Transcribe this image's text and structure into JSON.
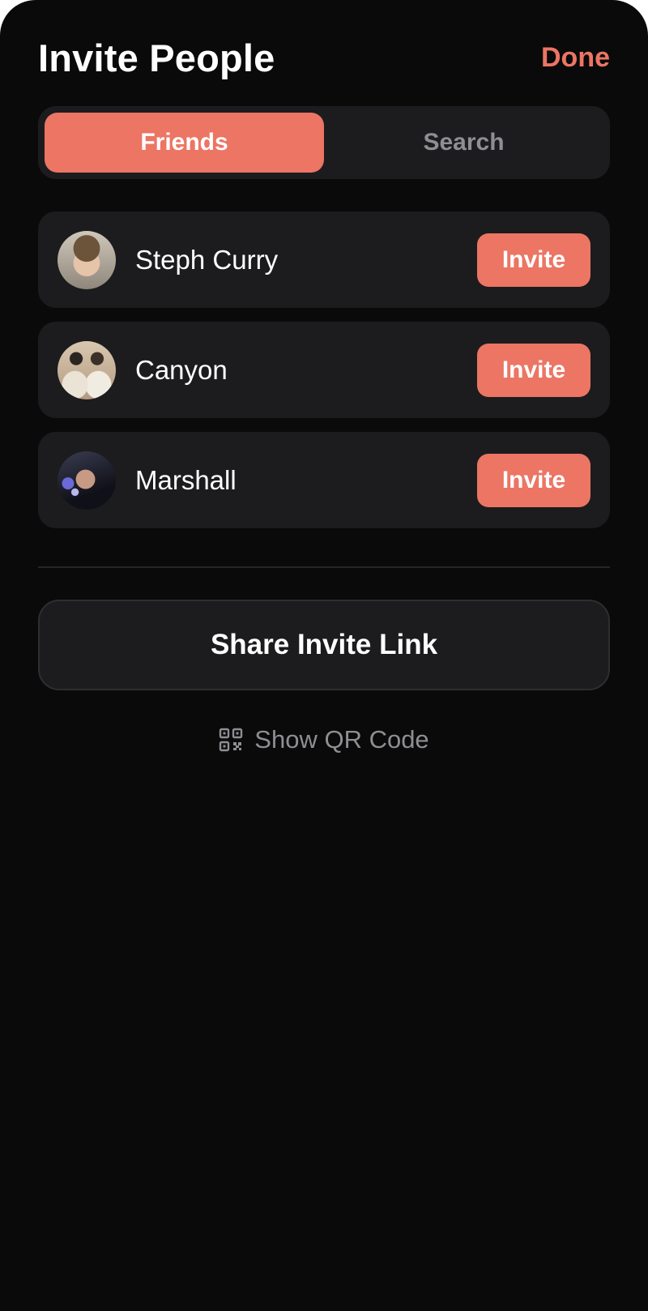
{
  "header": {
    "title": "Invite People",
    "done_label": "Done"
  },
  "tabs": [
    {
      "label": "Friends",
      "active": true
    },
    {
      "label": "Search",
      "active": false
    }
  ],
  "friends": [
    {
      "name": "Steph Curry",
      "action_label": "Invite",
      "avatar": "avatar-photo"
    },
    {
      "name": "Canyon",
      "action_label": "Invite",
      "avatar": "avatar-photo"
    },
    {
      "name": "Marshall",
      "action_label": "Invite",
      "avatar": "avatar-photo"
    }
  ],
  "share_link_label": "Share Invite Link",
  "qr": {
    "label": "Show QR Code",
    "icon": "qr-code-icon"
  },
  "colors": {
    "accent": "#ec7564",
    "background": "#0a0a0a",
    "card": "#1c1c1e",
    "muted_text": "#8e8e93"
  }
}
